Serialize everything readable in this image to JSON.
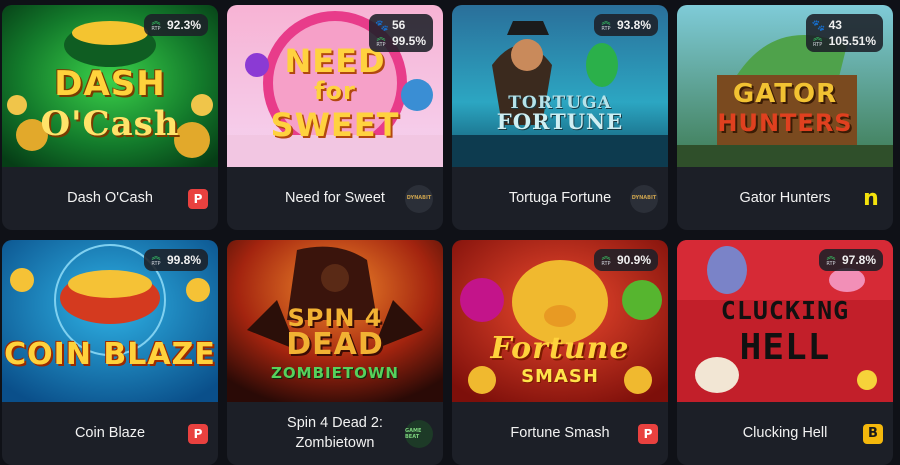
{
  "games": [
    {
      "name": "Dash O'Cash",
      "art_title_lines": [
        "DASH",
        "O'Cash"
      ],
      "rtp": "92.3%",
      "rtp_label": "RTP",
      "players": null,
      "provider_icon": "red-p-icon",
      "provider_glyph": "P"
    },
    {
      "name": "Need for Sweet",
      "art_title_lines": [
        "NEED",
        "for",
        "SWEET"
      ],
      "rtp": "99.5%",
      "rtp_label": "RTP",
      "players": "56",
      "provider_icon": "dynamite-logo-icon",
      "provider_glyph": "DYNABIT"
    },
    {
      "name": "Tortuga Fortune",
      "art_title_lines": [
        "TORTUGA",
        "FORTUNE"
      ],
      "rtp": "93.8%",
      "rtp_label": "RTP",
      "players": null,
      "provider_icon": "dynamite-logo-icon",
      "provider_glyph": "DYNABIT"
    },
    {
      "name": "Gator Hunters",
      "art_title_lines": [
        "GATOR",
        "HUNTERS"
      ],
      "rtp": "105.51%",
      "rtp_label": "RTP",
      "players": "43",
      "provider_icon": "yellow-n-icon",
      "provider_glyph": "n"
    },
    {
      "name": "Coin Blaze",
      "art_title_lines": [
        "COIN BLAZE"
      ],
      "rtp": "99.8%",
      "rtp_label": "RTP",
      "players": null,
      "provider_icon": "red-p-icon",
      "provider_glyph": "P"
    },
    {
      "name": "Spin 4 Dead 2: Zombietown",
      "art_title_lines": [
        "SPIN 4",
        "DEAD",
        "ZOMBIETOWN"
      ],
      "rtp": null,
      "rtp_label": "RTP",
      "players": null,
      "provider_icon": "gamebeat-logo-icon",
      "provider_glyph": "GAME BEAT"
    },
    {
      "name": "Fortune Smash",
      "art_title_lines": [
        "Fortune",
        "SMASH"
      ],
      "rtp": "90.9%",
      "rtp_label": "RTP",
      "players": null,
      "provider_icon": "red-p-icon",
      "provider_glyph": "P"
    },
    {
      "name": "Clucking Hell",
      "art_title_lines": [
        "CLUCKING",
        "HELL"
      ],
      "rtp": "97.8%",
      "rtp_label": "RTP",
      "players": null,
      "provider_icon": "yellow-b-icon",
      "provider_glyph": "B"
    }
  ],
  "colors": {
    "page_bg": "#0f1117",
    "card_bg": "#1c1f27",
    "rtp_accent": "#39d46a"
  }
}
